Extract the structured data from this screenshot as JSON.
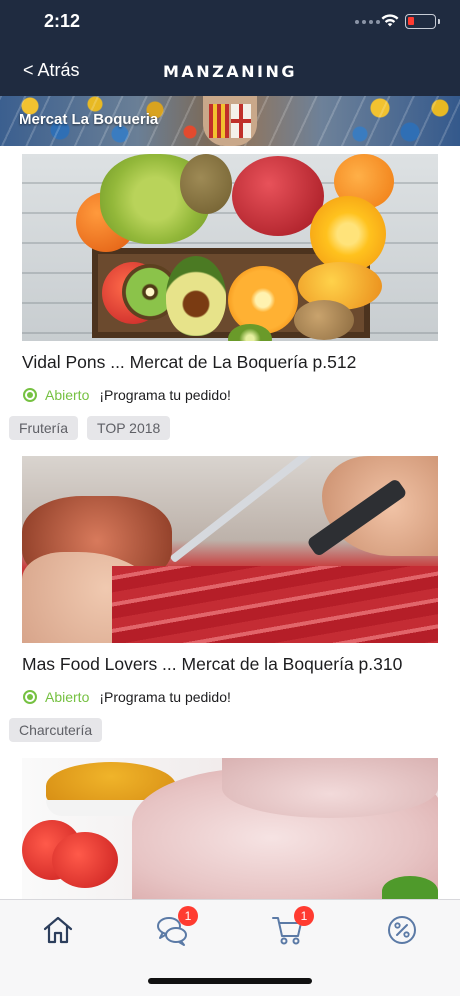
{
  "status_bar": {
    "time": "2:12"
  },
  "nav": {
    "back_label": "< Atrás",
    "brand": "MANZANING"
  },
  "banner": {
    "title": "Mercat La Boqueria"
  },
  "stores": [
    {
      "title": "Vidal Pons ... Mercat de La Boquería p.512",
      "status": "Abierto",
      "promo": "¡Programa tu pedido!",
      "tags": [
        "Frutería",
        "TOP 2018"
      ],
      "image": "fruit-crate"
    },
    {
      "title": "Mas Food Lovers ... Mercat de la Boquería p.310",
      "status": "Abierto",
      "promo": "¡Programa tu pedido!",
      "tags": [
        "Charcutería"
      ],
      "image": "ham-slicing"
    },
    {
      "image": "chicken-legs"
    }
  ],
  "tabbar": {
    "items": [
      {
        "name": "home",
        "icon": "home-icon"
      },
      {
        "name": "messages",
        "icon": "chat-icon",
        "badge": "1"
      },
      {
        "name": "cart",
        "icon": "cart-icon",
        "badge": "1"
      },
      {
        "name": "offers",
        "icon": "percent-icon"
      }
    ]
  },
  "colors": {
    "nav_bg": "#1f2b40",
    "open_green": "#76c142",
    "badge_red": "#ff3b30",
    "icon_blue": "#2c3e5c"
  }
}
